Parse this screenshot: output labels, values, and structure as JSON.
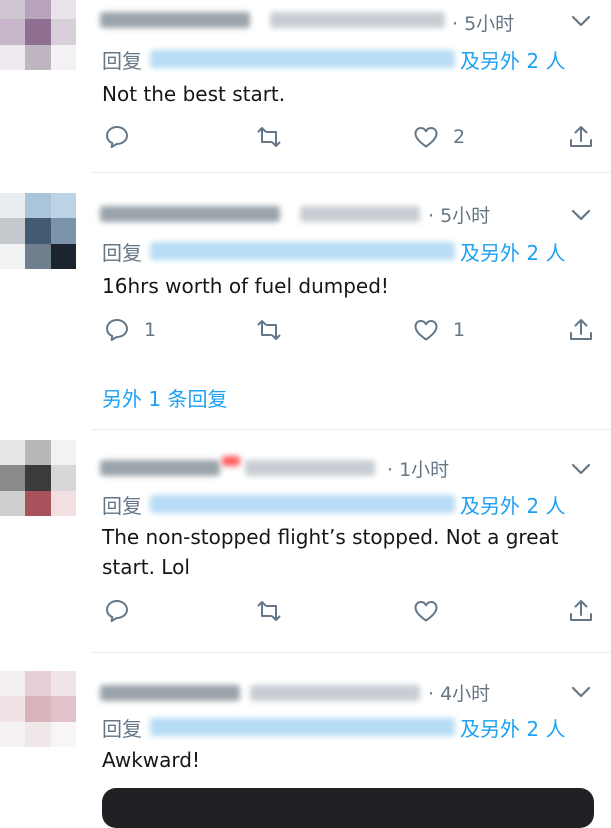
{
  "colors": {
    "link": "#1da1f2",
    "muted": "#657786",
    "text": "#14171a",
    "divider": "#e6ecf0"
  },
  "icons": {
    "reply": "reply-icon",
    "retweet": "retweet-icon",
    "like": "heart-icon",
    "share": "share-icon",
    "menu": "chevron-down-icon"
  },
  "tweets": [
    {
      "time": "· 5小时",
      "reply_prefix": "回复",
      "reply_others": "及另外 2 人",
      "text": "Not the best start.",
      "replies": "",
      "likes": "2"
    },
    {
      "time": "· 5小时",
      "reply_prefix": "回复",
      "reply_others": "及另外 2 人",
      "text": "16hrs worth of fuel dumped!",
      "replies": "1",
      "likes": "1",
      "more_replies": "另外 1 条回复"
    },
    {
      "time": "· 1小时",
      "reply_prefix": "回复",
      "reply_others": "及另外 2 人",
      "text": "The non-stopped flight’s stopped. Not a great start. Lol",
      "replies": "",
      "likes": ""
    },
    {
      "time": "· 4小时",
      "reply_prefix": "回复",
      "reply_others": "及另外 2 人",
      "text": "Awkward!",
      "replies": "",
      "likes": ""
    }
  ]
}
